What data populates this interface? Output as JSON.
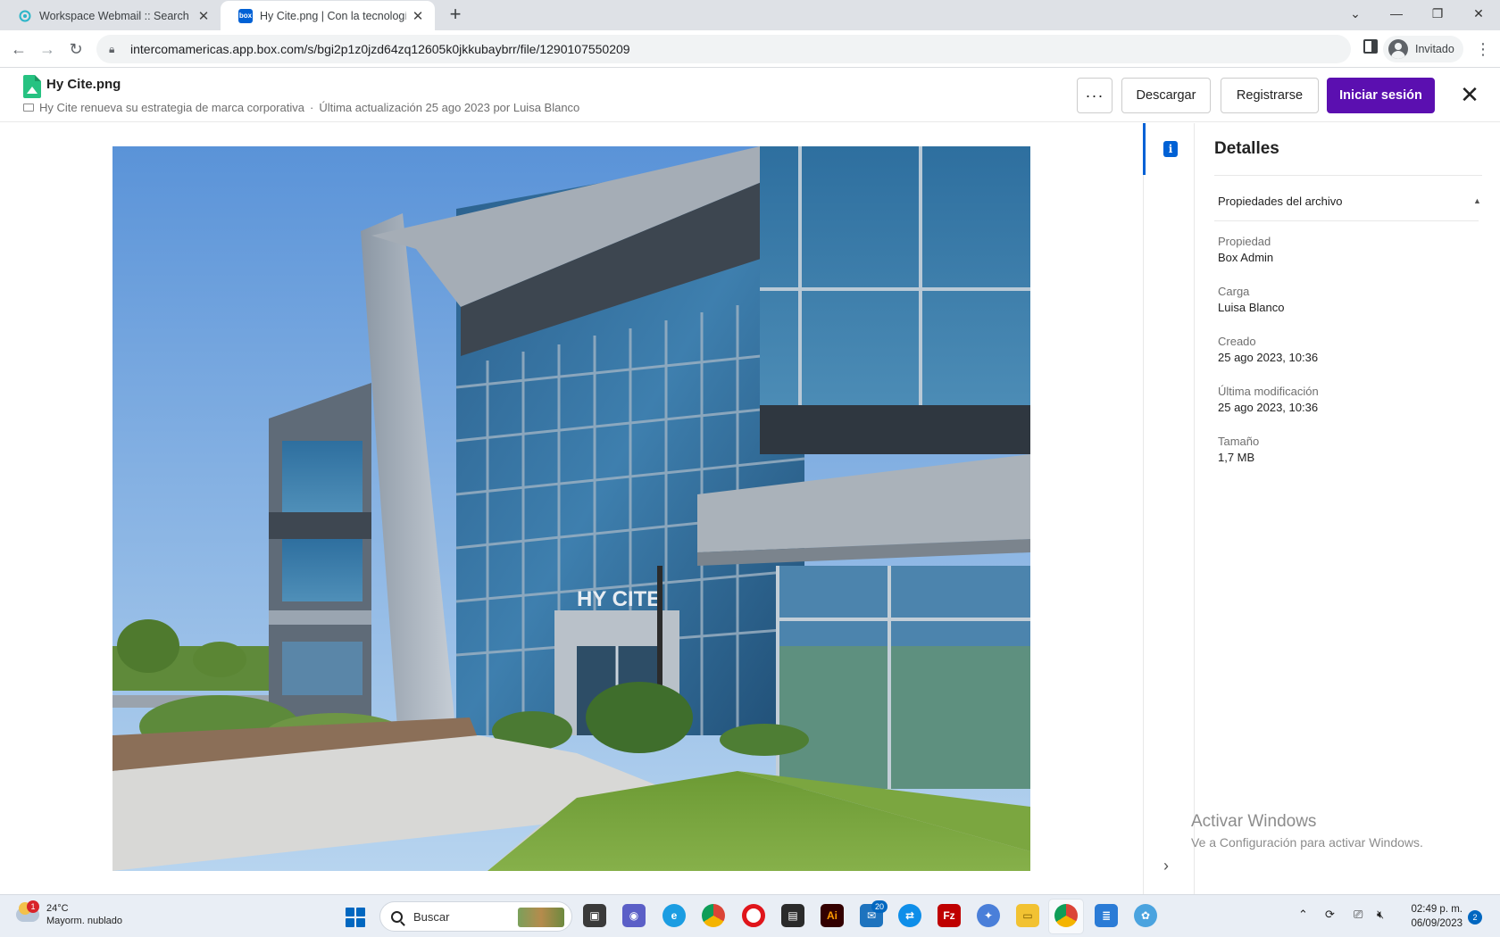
{
  "browser": {
    "tabs": [
      {
        "title": "Workspace Webmail :: Search Re",
        "active": false
      },
      {
        "title": "Hy Cite.png | Con la tecnología d",
        "active": true
      }
    ],
    "url": "intercomamericas.app.box.com/s/bgi2p1z0jzd64zq12605k0jkkubaybrr/file/1290107550209",
    "profile_label": "Invitado"
  },
  "header": {
    "file_name": "Hy Cite.png",
    "folder": "Hy Cite renueva su estrategia de marca corporativa",
    "separator": "·",
    "last_updated": "Última actualización 25 ago 2023 por Luisa Blanco",
    "more_label": "···",
    "download_label": "Descargar",
    "signup_label": "Registrarse",
    "login_label": "Iniciar sesión",
    "close_label": "✕",
    "accent_color": "#5b0fb0"
  },
  "preview": {
    "sign_text": "HY CITE"
  },
  "sidebar": {
    "title": "Detalles",
    "section_title": "Propiedades del archivo",
    "properties": [
      {
        "label": "Propiedad",
        "value": "Box Admin"
      },
      {
        "label": "Carga",
        "value": "Luisa Blanco"
      },
      {
        "label": "Creado",
        "value": "25 ago 2023, 10:36"
      },
      {
        "label": "Última modificación",
        "value": "25 ago 2023, 10:36"
      },
      {
        "label": "Tamaño",
        "value": "1,7 MB"
      }
    ]
  },
  "watermark": {
    "line1": "Activar Windows",
    "line2": "Ve a Configuración para activar Windows."
  },
  "taskbar": {
    "weather_badge": "1",
    "temperature": "24°C",
    "weather_desc": "Mayorm. nublado",
    "search_label": "Buscar",
    "mail_badge": "20",
    "time": "02:49 p. m.",
    "date": "06/09/2023",
    "notifications": "2"
  }
}
